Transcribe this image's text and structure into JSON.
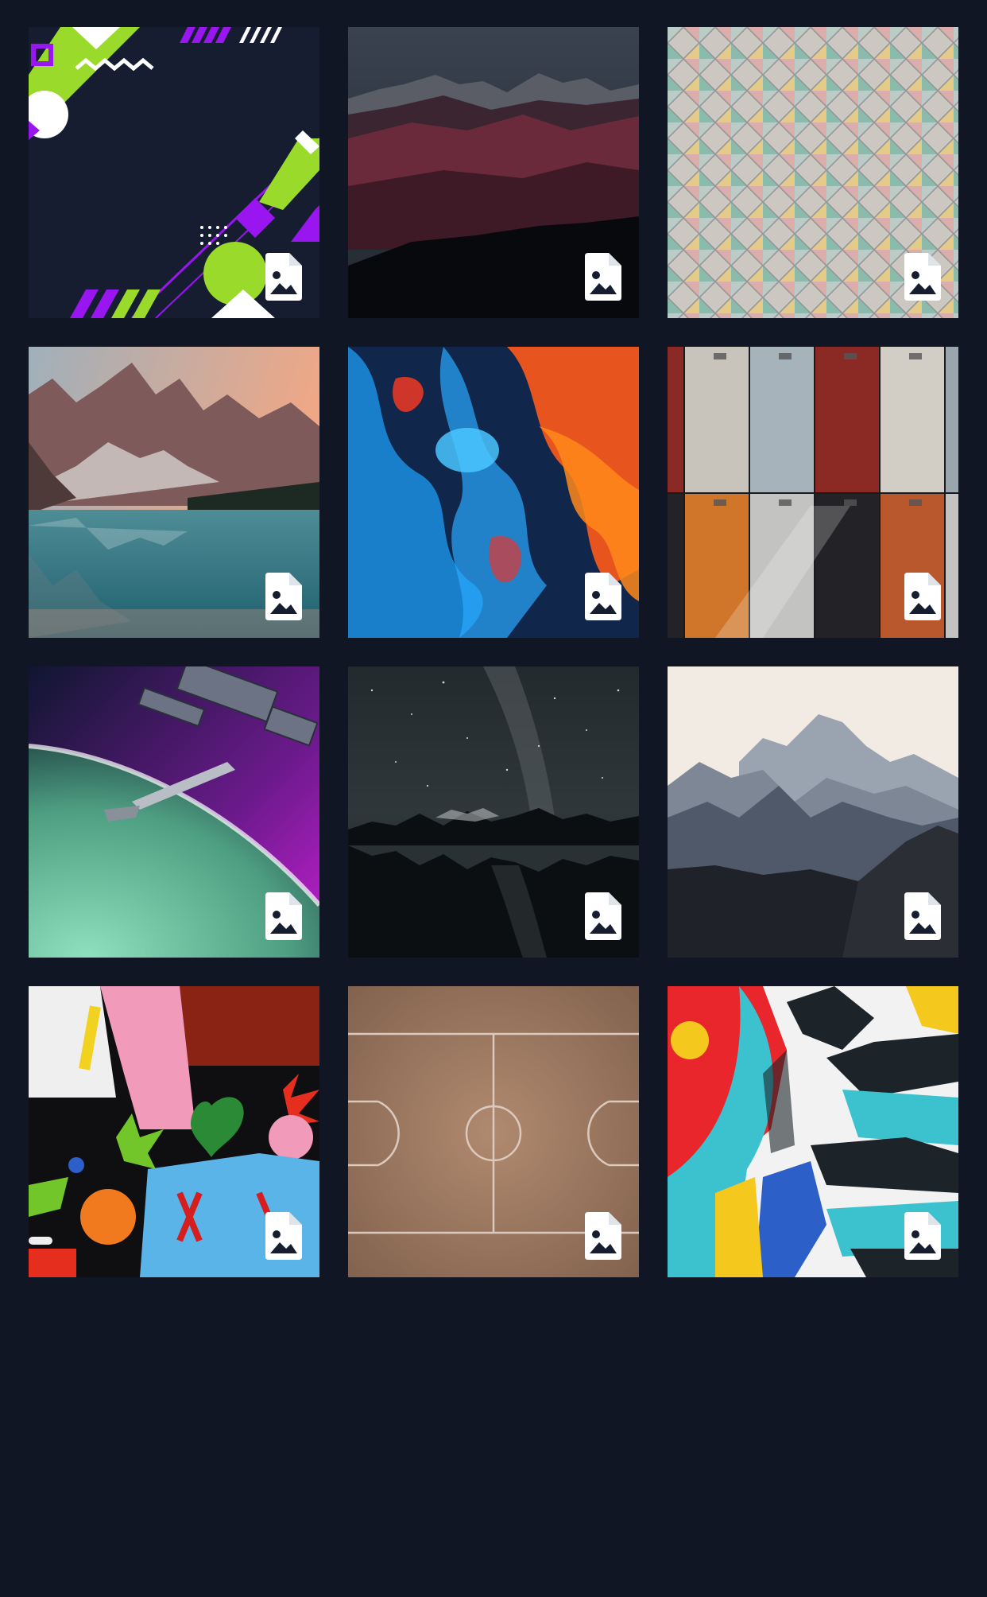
{
  "gallery": {
    "background_color": "#111625",
    "badge_icon": "image-file-icon",
    "items": [
      {
        "subject": "geometric-shapes",
        "colors": [
          "#161d30",
          "#9ada2b",
          "#9a16f0",
          "#ffffff"
        ]
      },
      {
        "subject": "mountain-range-dusk",
        "colors": [
          "#2d3440",
          "#6a2a3c",
          "#08090d"
        ]
      },
      {
        "subject": "pastel-scale-tiles",
        "colors": [
          "#b8c7c0",
          "#d9a8a4",
          "#7fb7a6",
          "#e2c77e"
        ]
      },
      {
        "subject": "mountain-lake-reflection",
        "colors": [
          "#f2a784",
          "#7e5a5a",
          "#2f7e8a"
        ]
      },
      {
        "subject": "ink-in-water",
        "colors": [
          "#1b8fe0",
          "#ff5a1a",
          "#11264b"
        ]
      },
      {
        "subject": "colored-lockers",
        "colors": [
          "#c8c4bc",
          "#8b2a25",
          "#d0762a",
          "#232327"
        ]
      },
      {
        "subject": "space-station-aurora",
        "colors": [
          "#2a1a4a",
          "#c21fd0",
          "#6ecba0"
        ]
      },
      {
        "subject": "milky-way-lake",
        "colors": [
          "#222a2e",
          "#5a5f62",
          "#0c0f12"
        ]
      },
      {
        "subject": "misty-peaks",
        "colors": [
          "#f2ebe4",
          "#7e8796",
          "#1f2228"
        ]
      },
      {
        "subject": "abstract-mural-shapes",
        "colors": [
          "#0f0f12",
          "#8b2315",
          "#f29ab9",
          "#5ab4e8"
        ]
      },
      {
        "subject": "basketball-court-top-view",
        "colors": [
          "#a78166",
          "#dcc9bd"
        ]
      },
      {
        "subject": "colorful-mural-stripes",
        "colors": [
          "#e8262b",
          "#3cc2cf",
          "#1d2429",
          "#f5c81e"
        ]
      }
    ]
  }
}
